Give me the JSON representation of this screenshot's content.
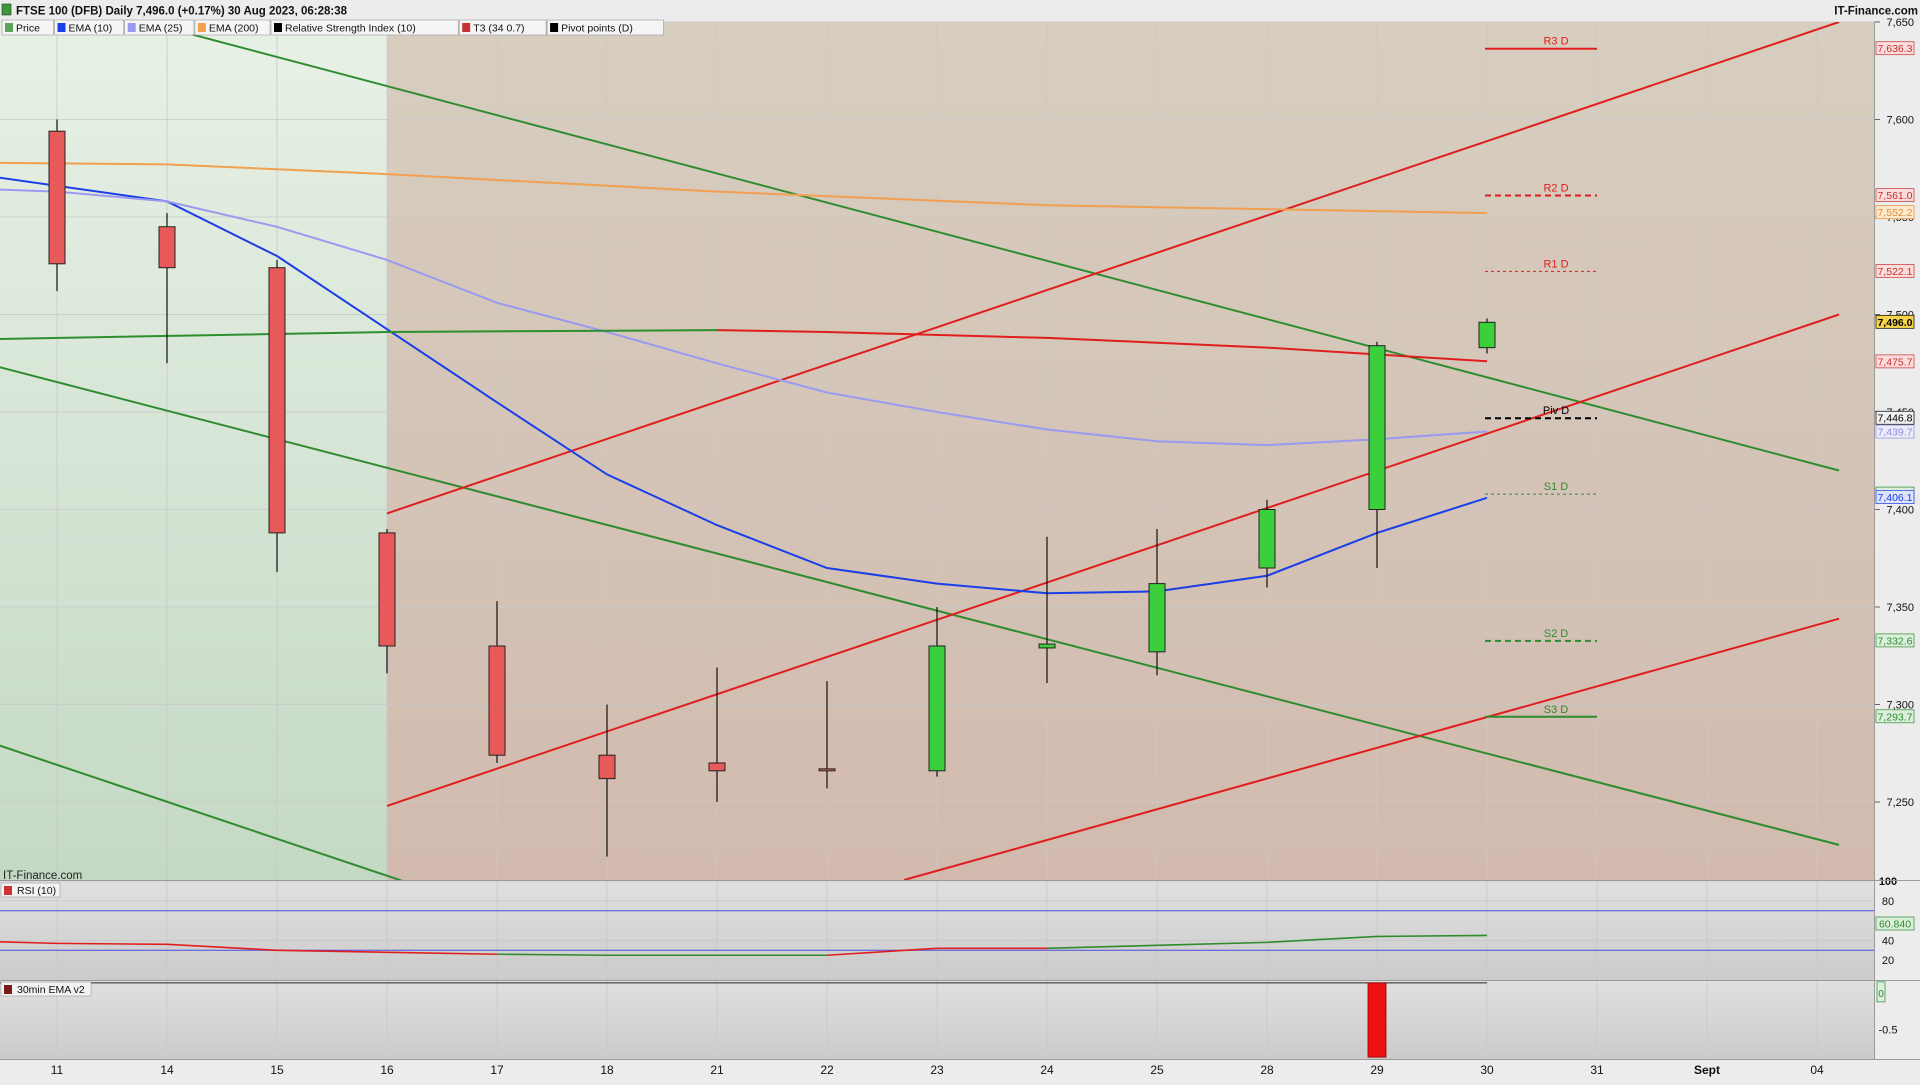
{
  "header": {
    "title": "FTSE 100 (DFB) Daily 7,496.0 (+0.17%) 30 Aug 2023, 06:28:38",
    "brand": "IT-Finance.com",
    "watermark": "IT-Finance.com"
  },
  "legend": [
    {
      "label": "Price",
      "color": "#5aa55a"
    },
    {
      "label": "EMA (10)",
      "color": "#1a3ee8"
    },
    {
      "label": "EMA (25)",
      "color": "#9a9af0"
    },
    {
      "label": "EMA (200)",
      "color": "#f0a050"
    },
    {
      "label": "Relative Strength Index (10)",
      "color": "#000000"
    },
    {
      "label": "T3 (34 0.7)",
      "color": "#c83232"
    },
    {
      "label": "Pivot points (D)",
      "color": "#000000"
    }
  ],
  "chart_data": [
    {
      "type": "candlestick",
      "name": "FTSE 100 (DFB) Daily",
      "x": [
        "11",
        "14",
        "15",
        "16",
        "17",
        "18",
        "21",
        "22",
        "23",
        "24",
        "25",
        "28",
        "29",
        "30",
        "31",
        "Sept",
        "04"
      ],
      "ylim": [
        7210,
        7650
      ],
      "y_ticks": [
        7250,
        7300,
        7350,
        7400,
        7450,
        7500,
        7550,
        7600,
        7650
      ],
      "candles": [
        {
          "x": "11",
          "open": 7594,
          "high": 7600,
          "low": 7512,
          "close": 7526
        },
        {
          "x": "14",
          "open": 7545,
          "high": 7552,
          "low": 7475,
          "close": 7524
        },
        {
          "x": "15",
          "open": 7524,
          "high": 7528,
          "low": 7368,
          "close": 7388
        },
        {
          "x": "16",
          "open": 7388,
          "high": 7390,
          "low": 7316,
          "close": 7330
        },
        {
          "x": "17",
          "open": 7330,
          "high": 7353,
          "low": 7270,
          "close": 7274
        },
        {
          "x": "18",
          "open": 7274,
          "high": 7300,
          "low": 7222,
          "close": 7262
        },
        {
          "x": "21",
          "open": 7270,
          "high": 7319,
          "low": 7250,
          "close": 7266
        },
        {
          "x": "22",
          "open": 7267,
          "high": 7312,
          "low": 7257,
          "close": 7266
        },
        {
          "x": "23",
          "open": 7266,
          "high": 7350,
          "low": 7263,
          "close": 7330
        },
        {
          "x": "24",
          "open": 7329,
          "high": 7386,
          "low": 7311,
          "close": 7331
        },
        {
          "x": "25",
          "open": 7327,
          "high": 7390,
          "low": 7315,
          "close": 7362
        },
        {
          "x": "28",
          "open": 7370,
          "high": 7405,
          "low": 7360,
          "close": 7400
        },
        {
          "x": "29",
          "open": 7400,
          "high": 7486,
          "low": 7370,
          "close": 7484
        },
        {
          "x": "30",
          "open": 7483,
          "high": 7498,
          "low": 7480,
          "close": 7496
        }
      ],
      "series": [
        {
          "name": "EMA (10)",
          "color": "#1a3ee8",
          "values": [
            [
              -1,
              7574
            ],
            [
              1,
              7558
            ],
            [
              2,
              7530
            ],
            [
              4,
              7455
            ],
            [
              5,
              7418
            ],
            [
              6,
              7392
            ],
            [
              7,
              7370
            ],
            [
              8,
              7362
            ],
            [
              9,
              7357
            ],
            [
              10,
              7358
            ],
            [
              11,
              7366
            ],
            [
              12,
              7388
            ],
            [
              13,
              7406
            ]
          ]
        },
        {
          "name": "EMA (25)",
          "color": "#9a9af0",
          "values": [
            [
              -1,
              7565
            ],
            [
              0,
              7563
            ],
            [
              1,
              7558
            ],
            [
              2,
              7545
            ],
            [
              3,
              7528
            ],
            [
              4,
              7506
            ],
            [
              5,
              7491
            ],
            [
              6,
              7475
            ],
            [
              7,
              7460
            ],
            [
              8,
              7450
            ],
            [
              9,
              7441
            ],
            [
              10,
              7435
            ],
            [
              11,
              7433
            ],
            [
              12,
              7436
            ],
            [
              13,
              7440
            ]
          ]
        },
        {
          "name": "EMA (200)",
          "color": "#f0a050",
          "values": [
            [
              -1,
              7578
            ],
            [
              1,
              7577
            ],
            [
              3,
              7572
            ],
            [
              6,
              7563
            ],
            [
              9,
              7556
            ],
            [
              13,
              7552
            ]
          ]
        },
        {
          "name": "T3 (34 0.7)",
          "color": "#2e8f2e",
          "values": [
            [
              -1,
              7487
            ],
            [
              3,
              7491
            ],
            [
              6,
              7492
            ]
          ]
        },
        {
          "name": "T3 (34 0.7)",
          "color": "#e01e1e",
          "values": [
            [
              6,
              7492
            ],
            [
              7,
              7491
            ],
            [
              9,
              7488
            ],
            [
              11,
              7483
            ],
            [
              13,
              7476
            ]
          ]
        }
      ],
      "channels": [
        {
          "color": "#2e8b2e",
          "lines": [
            [
              [
                0.8,
                7650
              ],
              [
                16.2,
                7420
              ]
            ],
            [
              [
                -1,
                7480
              ],
              [
                16.2,
                7228
              ]
            ],
            [
              [
                -1,
                7288
              ],
              [
                8.5,
                7108
              ]
            ]
          ]
        },
        {
          "color": "#e01e1e",
          "lines": [
            [
              [
                3,
                7398
              ],
              [
                16.2,
                7650
              ]
            ],
            [
              [
                3,
                7248
              ],
              [
                16.2,
                7500
              ]
            ],
            [
              [
                7.7,
                7210
              ],
              [
                16.2,
                7344
              ]
            ]
          ]
        }
      ],
      "channel_fill": {
        "start": 3,
        "start_x": "16"
      },
      "pivots": [
        {
          "label": "R3 D",
          "value": 7636.3,
          "color": "#e01e1e",
          "style": "solid"
        },
        {
          "label": "R2 D",
          "value": 7561.0,
          "color": "#e01e1e",
          "style": "dashed"
        },
        {
          "label": "R1 D",
          "value": 7522.1,
          "color": "#e01e1e",
          "style": "dotted"
        },
        {
          "label": "Piv D",
          "value": 7446.8,
          "color": "#000000",
          "style": "dashed"
        },
        {
          "label": "S1 D",
          "value": 7407.9,
          "color": "#2e8b2e",
          "style": "dotted"
        },
        {
          "label": "S2 D",
          "value": 7332.6,
          "color": "#2e8b2e",
          "style": "dashed"
        },
        {
          "label": "S3 D",
          "value": 7293.7,
          "color": "#2e8b2e",
          "style": "solid"
        }
      ],
      "right_labels": [
        {
          "value": 7636.3,
          "text": "7,636.3",
          "color": "#c83232",
          "bg": "#fadcdc"
        },
        {
          "value": 7561.0,
          "text": "7,561.0",
          "color": "#c83232",
          "bg": "#fadcdc"
        },
        {
          "value": 7552.2,
          "text": "7,552.2",
          "color": "#e0902e",
          "bg": "#fde8d0"
        },
        {
          "value": 7522.1,
          "text": "7,522.1",
          "color": "#c83232",
          "bg": "#fadcdc"
        },
        {
          "value": 7496.0,
          "text": "7,496.0",
          "color": "#000000",
          "bg": "#f6d34a"
        },
        {
          "value": 7475.7,
          "text": "7,475.7",
          "color": "#c83232",
          "bg": "#fadcdc"
        },
        {
          "value": 7446.8,
          "text": "7,446.8",
          "color": "#000000",
          "bg": "#f0f0f0"
        },
        {
          "value": 7439.7,
          "text": "7,439.7",
          "color": "#8f8fe0",
          "bg": "#eaeaf8"
        },
        {
          "value": 7407.9,
          "text": "7,407.9",
          "color": "#2e8b2e",
          "bg": "#dcefdc"
        },
        {
          "value": 7406.1,
          "text": "7,406.1",
          "color": "#1a3ee8",
          "bg": "#dde3fa"
        },
        {
          "value": 7332.6,
          "text": "7,332.6",
          "color": "#2e8b2e",
          "bg": "#dcefdc"
        },
        {
          "value": 7293.7,
          "text": "7,293.7",
          "color": "#2e8b2e",
          "bg": "#dcefdc"
        }
      ]
    },
    {
      "type": "line",
      "name": "RSI (10)",
      "title": "RSI (10)",
      "ylim": [
        0,
        100
      ],
      "y_ticks": [
        20,
        40,
        80,
        100
      ],
      "levels": [
        30,
        70
      ],
      "values": [
        [
          -1,
          40
        ],
        [
          0,
          37
        ],
        [
          1,
          36
        ],
        [
          2,
          30
        ],
        [
          3,
          28
        ],
        [
          4,
          26
        ],
        [
          5,
          25
        ],
        [
          6,
          25
        ],
        [
          7,
          25
        ],
        [
          8,
          32
        ],
        [
          9,
          32
        ],
        [
          10,
          35
        ],
        [
          11,
          38
        ],
        [
          12,
          44
        ],
        [
          13,
          45
        ]
      ],
      "last_label": "60.840"
    },
    {
      "type": "bar",
      "name": "30min EMA v2",
      "title": "30min EMA v2",
      "ylim": [
        -0.82,
        0.02
      ],
      "y_ticks": [
        0,
        -0.5
      ],
      "bars": [
        {
          "x": "29",
          "value": -0.8
        }
      ],
      "zero_label": "0"
    }
  ]
}
